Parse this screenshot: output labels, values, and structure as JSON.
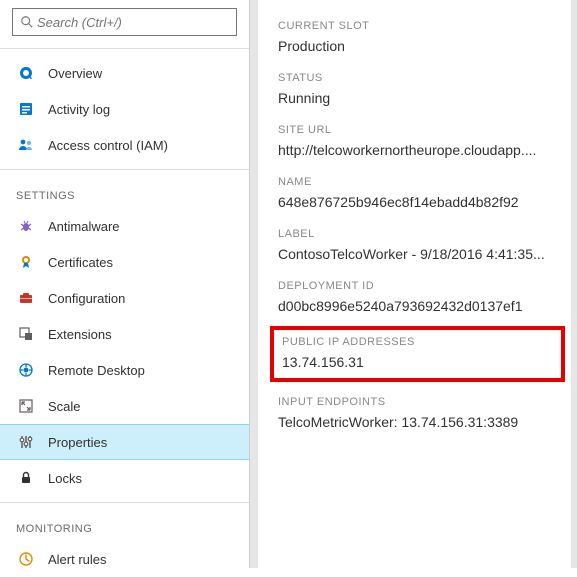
{
  "search": {
    "placeholder": "Search (Ctrl+/)"
  },
  "nav": {
    "top": [
      {
        "label": "Overview",
        "icon": "overview-icon"
      },
      {
        "label": "Activity log",
        "icon": "log-icon"
      },
      {
        "label": "Access control (IAM)",
        "icon": "access-icon"
      }
    ],
    "section_settings": "SETTINGS",
    "settings": [
      {
        "label": "Antimalware",
        "icon": "antimalware-icon"
      },
      {
        "label": "Certificates",
        "icon": "certificate-icon"
      },
      {
        "label": "Configuration",
        "icon": "configuration-icon"
      },
      {
        "label": "Extensions",
        "icon": "extensions-icon"
      },
      {
        "label": "Remote Desktop",
        "icon": "remote-icon"
      },
      {
        "label": "Scale",
        "icon": "scale-icon"
      },
      {
        "label": "Properties",
        "icon": "properties-icon",
        "selected": true
      },
      {
        "label": "Locks",
        "icon": "locks-icon"
      }
    ],
    "section_monitoring": "MONITORING",
    "monitoring": [
      {
        "label": "Alert rules",
        "icon": "alert-icon"
      }
    ]
  },
  "details": {
    "current_slot": {
      "label": "CURRENT SLOT",
      "value": "Production"
    },
    "status": {
      "label": "STATUS",
      "value": "Running"
    },
    "site_url": {
      "label": "SITE URL",
      "value": "http://telcoworkernortheurope.cloudapp...."
    },
    "name": {
      "label": "NAME",
      "value": "648e876725b946ec8f14ebadd4b82f92"
    },
    "label_field": {
      "label": "LABEL",
      "value": "ContosoTelcoWorker - 9/18/2016 4:41:35..."
    },
    "deployment_id": {
      "label": "DEPLOYMENT ID",
      "value": "d00bc8996e5240a793692432d0137ef1"
    },
    "public_ip": {
      "label": "PUBLIC IP ADDRESSES",
      "value": "13.74.156.31"
    },
    "input_endpoints": {
      "label": "INPUT ENDPOINTS",
      "value": "TelcoMetricWorker: 13.74.156.31:3389"
    }
  },
  "icons": {
    "color_blue": "#0078d4",
    "color_orange": "#d98f00",
    "color_gray": "#605e5c",
    "color_black": "#323130",
    "color_purple": "#8661c5"
  }
}
